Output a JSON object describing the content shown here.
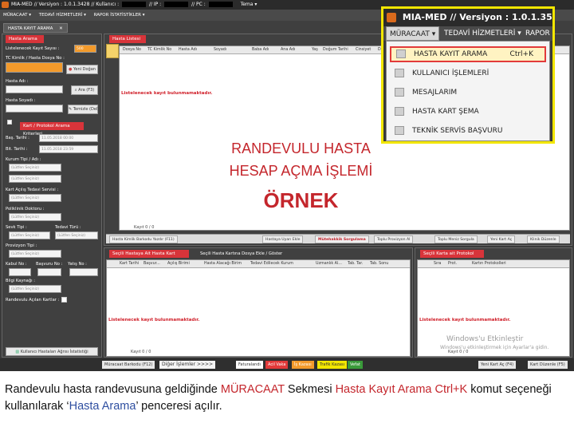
{
  "window": {
    "title_parts": [
      "MIA-MED // Versiyon : 1.0.1.3428 // Kullanıcı :",
      "// IP :",
      "// PC :"
    ],
    "theme_label": "Tema ▾"
  },
  "menubar": [
    "MÜRACAAT ▾",
    "TEDAVİ HİZMETLERİ ▾",
    "RAPOR İSTATİSTİKLER ▾"
  ],
  "doc_tab": "HASTA KAYIT ARAMA",
  "left_panel": {
    "header1": "Hasta Arama",
    "kayit_label": "Listelenecek Kayıt Sayısı :",
    "kayit_value": "500",
    "tc_label": "TC Kimlik / Hasta Dosya No :",
    "yeni_dogan": "Yeni Doğan",
    "ad_label": "Hasta Adı :",
    "soyad_label": "Hasta Soyadı :",
    "ara_btn": "Ara (F3)",
    "temizle_btn": "Temizle (Del)",
    "header2": "Kart / Protokol Arama Kriterleri",
    "baslangic_label": "Baş. Tarihi :",
    "baslangic_value": "11.05.2018 00:00",
    "bitis_label": "Bit. Tarihi :",
    "bitis_value": "11.05.2018 23:59",
    "kurum_label": "Kurum Tipi / Adı :",
    "placeholder": "(Lütfen Seçiniz)",
    "klinik_label": "Kart Açılış Tedavi Servisi :",
    "poliklinik_label": "Poliklinik Doktoru :",
    "sevk_label": "Sevk Tipi :",
    "tedavi_label": "Tedavi Türü :",
    "provizyon_label": "Provizyon Tipi :",
    "kabul_label": "Kabul No :",
    "basvuru_label": "Başvuru No :",
    "yatis_label": "Yatış No :",
    "bilgi_label": "Bilgi Kaynağı :",
    "acilan_label": "Randevulu Açılan Kartlar :",
    "bottom_btn": "Kullanıcı Hastaları Ağrısı İstatistiği"
  },
  "top_grid": {
    "header": "Hasta Listesi",
    "columns": [
      "Dosya No",
      "TC Kimlik No",
      "Hasta Adı",
      "Soyadı",
      "Baba Adı",
      "Ana Adı",
      "Yaş",
      "Doğum Tarihi",
      "Cinsiyet",
      "Doğum"
    ],
    "empty_text": "Listelenecek kayıt bulunmamaktadır.",
    "pager": "Kayıt 0 / 0",
    "toolbar": [
      "Hasta Kimlik Barkodu Yazdır (F11)",
      "Hastaya Uyarı Ekle",
      "Mütehakkik Sorgulama",
      "Toplu Provizyon Al",
      "Toplu Meniz Sorgula",
      "Yeni Kart Aç",
      "Klinik Düzenle"
    ]
  },
  "bottom_left_grid": {
    "tab1": "Seçili Hastaya Ait Hasta Kart Bilgileri",
    "tab2": "Seçili Hasta Kartına Dosya Ekle / Göster",
    "columns": [
      "Kart Tarihi",
      "Başvur...",
      "Açılış Birimi",
      "Hasta Alacağı Birim",
      "Tedavi Edilecek Kurum",
      "Uzmanlık Al...",
      "Tab. Tar.",
      "Tab. Sonu"
    ],
    "empty_text": "Listelenecek kayıt bulunmamaktadır.",
    "pager": "Kayıt 0 / 0"
  },
  "bottom_right_grid": {
    "tab": "Seçili Karta ait Protokol Bilgileri",
    "columns": [
      "Sıra",
      "Prot.",
      "Kartın Protokolleri"
    ],
    "empty_text": "Listelenecek kayıt bulunmamaktadır.",
    "pager": "Kayıt 0 / 0"
  },
  "watermark": {
    "line1": "Windows'u Etkinleştir",
    "line2": "Windows'u etkinleştirmek için Ayarlar'a gidin."
  },
  "statusbar": [
    "Müracaat Barkodu (F12)",
    "Diğer İşlemler >>>>",
    "Faturalandı",
    "Acil Vaka",
    "İş Kazası",
    "Trafik Kazası",
    "Vefat",
    "Yeni Kart Aç (F4)",
    "Kart Düzenle (F5)"
  ],
  "overlay": {
    "line1": "RANDEVULU HASTA",
    "line2": "HESAP AÇMA İŞLEMİ",
    "line3": "ÖRNEK"
  },
  "zoom": {
    "title": "MIA-MED // Versiyon : 1.0.1.3538 //",
    "menus": [
      "MÜRACAAT ▾",
      "TEDAVİ HİZMETLERİ ▾",
      "RAPOR"
    ],
    "items": [
      {
        "label": "HASTA KAYIT ARAMA",
        "shortcut": "Ctrl+K"
      },
      {
        "label": "KULLANICI İŞLEMLERİ",
        "shortcut": ""
      },
      {
        "label": "MESAJLARIM",
        "shortcut": ""
      },
      {
        "label": "HASTA KART ŞEMA",
        "shortcut": ""
      },
      {
        "label": "TEKNİK SERVİS BAŞVURU",
        "shortcut": ""
      }
    ]
  },
  "caption": {
    "p1": "Randevulu hasta randevusuna geldiğinde ",
    "h1": "MÜRACAAT",
    "p2": " Sekmesi ",
    "h2": "Hasta Kayıt Arama Ctrl+K",
    "p3": " komut seçeneği kullanılarak ‘",
    "h3": "Hasta Arama",
    "p4": "’ penceresi açılır."
  },
  "colors": {
    "accent_red": "#c4262c",
    "highlight_yellow": "#f2e600",
    "orange_field": "#f39a2b"
  }
}
